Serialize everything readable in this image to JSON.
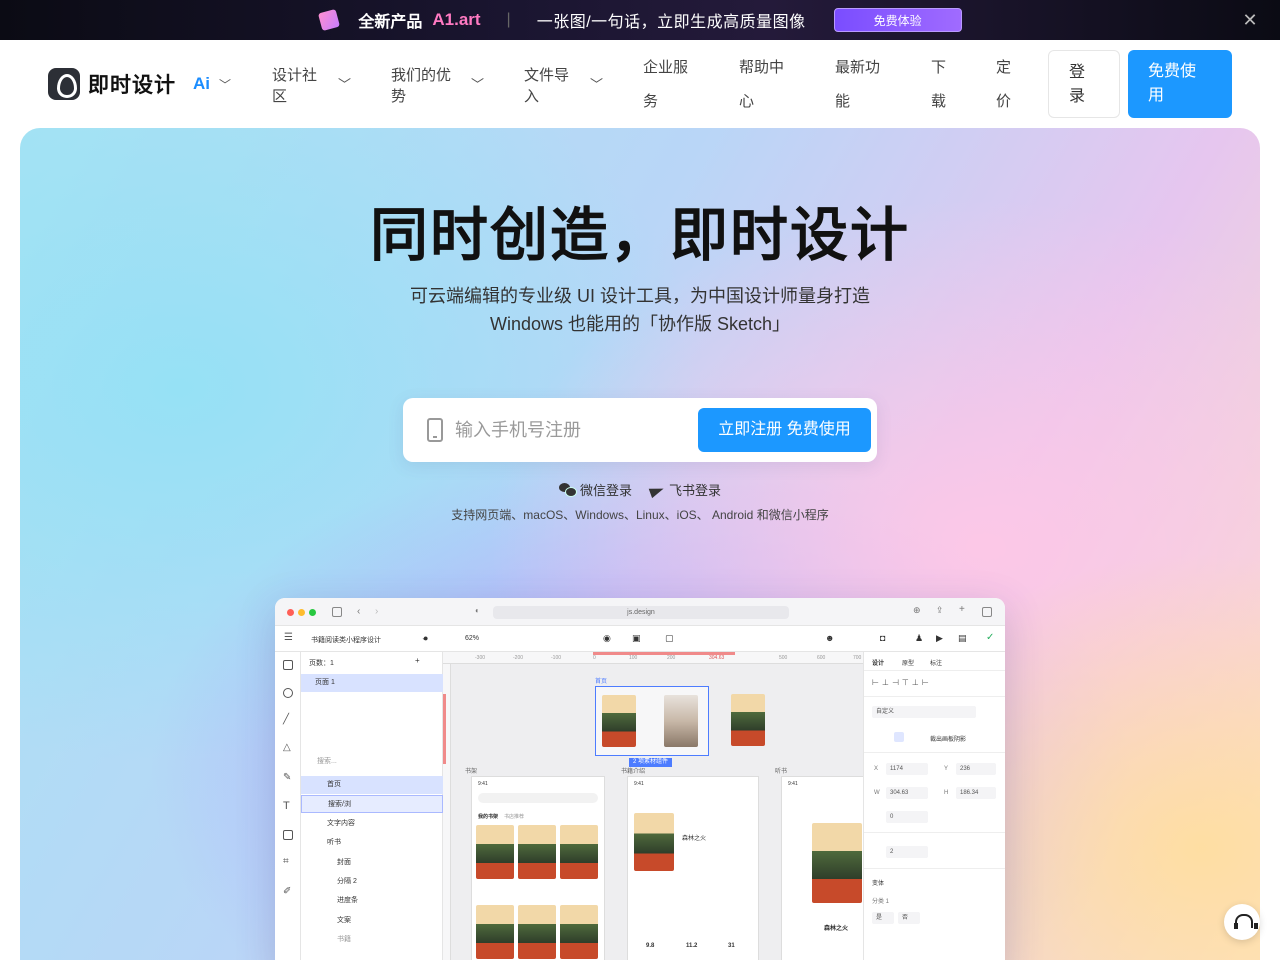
{
  "promo": {
    "title": "全新产品",
    "brand": "A1.art",
    "tagline": "一张图/一句话，立即生成高质量图像",
    "cta": "免费体验",
    "close": "✕"
  },
  "nav": {
    "logo_text": "即时设计",
    "ai_label": "Ai",
    "items": [
      {
        "label": "设计社\n区"
      },
      {
        "label": "我们的优\n势"
      },
      {
        "label": "文件导\n入"
      },
      {
        "label": "企业服\n\n务"
      },
      {
        "label": "帮助中\n\n心"
      },
      {
        "label": "最新功\n\n能"
      },
      {
        "label": "下\n\n载"
      },
      {
        "label": "定\n\n价"
      }
    ],
    "login": "登\n录",
    "signup": "免费使\n用"
  },
  "hero": {
    "title": "同时创造，即时设计",
    "subtitle_line1": "可云端编辑的专业级 UI 设计工具，为中国设计师量身打造",
    "subtitle_line2": "Windows 也能用的「协作版 Sketch」",
    "phone_placeholder": "输入手机号注册",
    "register_button": "立即注册 免费使用",
    "wechat_login": "微信登录",
    "feishu_login": "飞书登录",
    "platforms": "支持网页端、macOS、Windows、Linux、iOS、 Android 和微信小程序"
  },
  "app": {
    "url": "js.design",
    "file_name": "书籍阅读类小程序设计",
    "zoom": "62%",
    "page_header": "页数：1",
    "page_item": "页面 1",
    "search_placeholder": "搜索...",
    "layers": [
      "首页",
      "搜索/浏",
      "文字内容",
      "听书",
      "封面",
      "分隔 2",
      "进度条",
      "文案",
      "书籍"
    ],
    "frame_label": "首页",
    "group_label": "2 项素材组件",
    "canvas_labels": [
      "书架",
      "书籍介绍",
      "听书"
    ],
    "ruler": [
      "-300",
      "-200",
      "-100",
      "0",
      "100",
      "200",
      "304.63",
      "500",
      "600",
      "700"
    ],
    "panel_tabs": [
      "设计",
      "原型",
      "标注"
    ],
    "panel": {
      "custom": "自定义",
      "clip": "裁出画板阴影",
      "x": "1174",
      "y": "236",
      "w": "304.63",
      "h": "186.34",
      "rotation": "0",
      "radius": "2",
      "section": "变体",
      "group": "分类 1",
      "yes": "是",
      "no": "否"
    },
    "phone": {
      "time": "9:41",
      "tab1": "我的书架",
      "tab2": "书店推荐",
      "book_title": "森林之火",
      "rating": "9.8",
      "count": "11.2",
      "days": "31"
    }
  }
}
